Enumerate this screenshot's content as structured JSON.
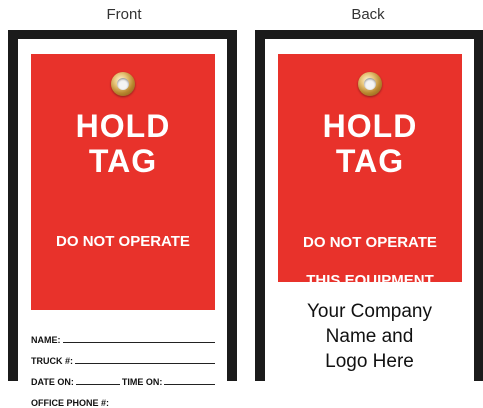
{
  "front": {
    "caption": "Front",
    "hold_line1": "HOLD",
    "hold_line2": "TAG",
    "notice_line1": "DO NOT OPERATE",
    "fields": {
      "name": "NAME:",
      "truck": "TRUCK #:",
      "date_on": "DATE ON:",
      "time_on": "TIME ON:",
      "office_phone": "OFFICE PHONE #:"
    }
  },
  "back": {
    "caption": "Back",
    "hold_line1": "HOLD",
    "hold_line2": "TAG",
    "notice_line1": "DO NOT OPERATE",
    "notice_line2": "THIS EQUIPMENT",
    "company_line1": "Your Company",
    "company_line2": "Name and",
    "company_line3": "Logo Here"
  },
  "colors": {
    "tag_red": "#e8322b",
    "tag_border": "#1b1b1b",
    "brass": "#c99a45"
  },
  "icons": {
    "grommet": "brass-grommet-icon"
  }
}
